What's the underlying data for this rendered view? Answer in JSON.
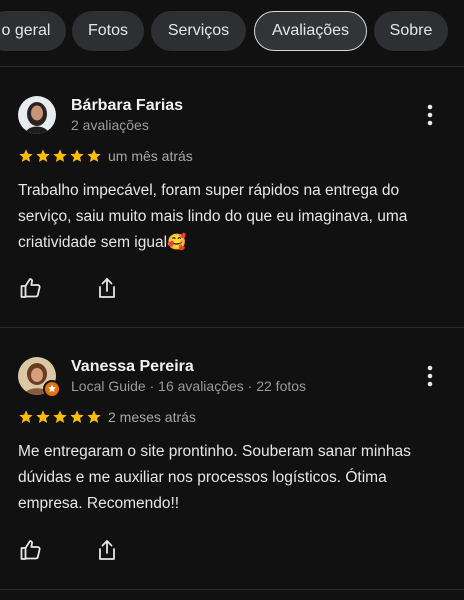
{
  "tabs": [
    {
      "label": "o geral",
      "active": false
    },
    {
      "label": "Fotos",
      "active": false
    },
    {
      "label": "Serviços",
      "active": false
    },
    {
      "label": "Avaliações",
      "active": true
    },
    {
      "label": "Sobre",
      "active": false
    }
  ],
  "reviews": [
    {
      "name": "Bárbara Farias",
      "meta": "2 avaliações",
      "rating": 5,
      "date": "um mês atrás",
      "text": "Trabalho impecável, foram super rápidos na entrega do serviço, saiu muito mais lindo do que eu imaginava, uma criatividade sem igual",
      "emoji": "🥰"
    },
    {
      "name": "Vanessa Pereira",
      "meta": "Local Guide · 16 avaliações · 22 fotos",
      "rating": 5,
      "date": "2 meses atrás",
      "text": "Me entregaram o site prontinho. Souberam sanar minhas dúvidas e me auxiliar nos processos logísticos. Ótima empresa. Recomendo!!",
      "emoji": ""
    }
  ],
  "colors": {
    "background": "#111111",
    "star": "#fbbc04",
    "tab_bg": "#2e2f33",
    "muted_text": "#9a9a9a"
  },
  "icons": {
    "like": "thumb-up-icon",
    "share": "share-icon",
    "more": "more-vert-icon",
    "star": "star-icon"
  }
}
